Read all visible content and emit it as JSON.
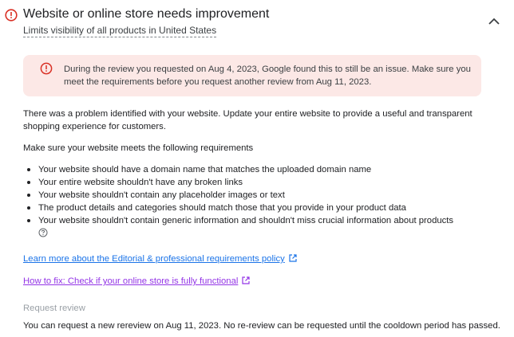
{
  "issue": {
    "title": "Website or online store needs improvement",
    "subtitle": "Limits visibility of all products in United States",
    "icon": "error-icon",
    "status_color": "#d93025"
  },
  "alert": {
    "text": "During the review you requested on Aug 4, 2023, Google found this to still be an issue. Make sure you meet the requirements before you request another review from Aug 11, 2023.",
    "background": "#fce8e6"
  },
  "body": {
    "problem": "There was a problem identified with your website. Update your entire website to provide a useful and transparent shopping experience for customers.",
    "requirements_intro": "Make sure your website meets the following requirements",
    "requirements": [
      "Your website should have a domain name that matches the uploaded domain name",
      "Your entire website shouldn't have any broken links",
      "Your website shouldn't contain any placeholder images or text",
      "The product details and categories should match those that you provide in your product data",
      "Your website shouldn't contain generic information and shouldn't miss crucial information about products"
    ]
  },
  "links": {
    "policy": "Learn more about the Editorial & professional requirements policy",
    "how_to_fix": "How to fix: Check if your online store is fully functional"
  },
  "request_review": {
    "label": "Request review",
    "text": "You can request a new rereview on Aug 11, 2023. No re-review can be requested until the cooldown period has passed."
  }
}
